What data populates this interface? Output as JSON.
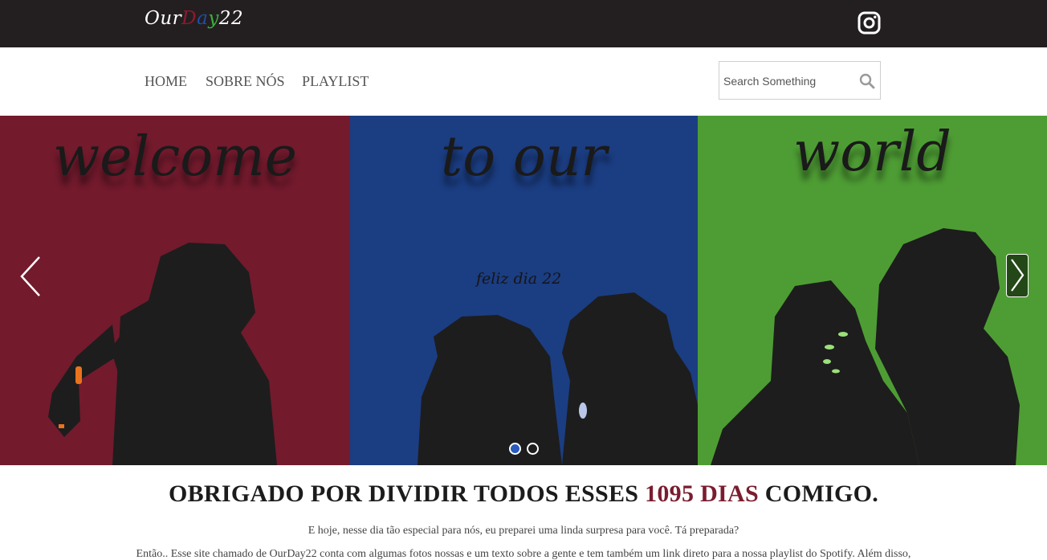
{
  "brand": {
    "logo_parts": [
      "Our",
      "D",
      "a",
      "y",
      "22"
    ],
    "colors": {
      "dark": "#231f20",
      "red": "#8e1a2e",
      "blue": "#1f4fa8",
      "green": "#3cae3c",
      "accent": "#7a1d2f"
    }
  },
  "topbar": {
    "social_icon": "instagram-icon"
  },
  "nav": {
    "items": [
      "HOME",
      "SOBRE NÓS",
      "PLAYLIST"
    ],
    "search": {
      "placeholder": "Search Something",
      "value": "",
      "icon": "search-icon"
    }
  },
  "carousel": {
    "panels": [
      {
        "word": "welcome",
        "color": "#731a2d"
      },
      {
        "word": "to our",
        "color": "#1b3d82"
      },
      {
        "word": "world",
        "color": "#4e9d34"
      }
    ],
    "subtitle": "feliz dia 22",
    "prev_icon": "chevron-left-icon",
    "next_icon": "chevron-right-icon",
    "slide_count": 2,
    "active_slide": 1
  },
  "content": {
    "headline_before": "OBRIGADO POR DIVIDIR TODOS ESSES ",
    "headline_accent": "1095 DIAS",
    "headline_after": " COMIGO.",
    "paragraph_1": "E hoje, nesse dia tão especial para nós, eu preparei uma linda surpresa para você. Tá preparada?",
    "paragraph_2": "Então.. Esse site chamado de OurDay22 conta com algumas fotos nossas e um texto sobre a gente e tem também um link direto para a nossa playlist do Spotify. Além disso,"
  }
}
